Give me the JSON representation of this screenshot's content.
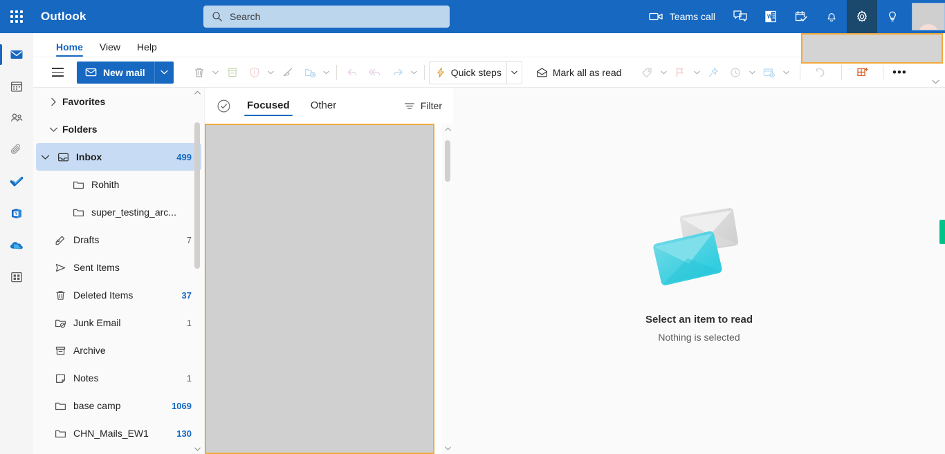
{
  "app": {
    "brand": "Outlook",
    "accent_blue": "#1668c1",
    "highlight_orange": "#f2a93b",
    "green_marker": "#00c389"
  },
  "header": {
    "waffle_name": "app-launcher-icon",
    "search": {
      "placeholder": "Search",
      "value": "",
      "icon": "search-icon"
    },
    "right_items": [
      {
        "id": "teams-call",
        "label": "Teams call",
        "icon": "video-camera-icon",
        "active": false
      },
      {
        "id": "chat",
        "label": "",
        "icon": "chat-bubbles-icon",
        "active": false
      },
      {
        "id": "office-app",
        "label": "",
        "icon": "office-word-icon",
        "active": false
      },
      {
        "id": "to-do",
        "label": "",
        "icon": "calendar-check-icon",
        "active": false
      },
      {
        "id": "notifications",
        "label": "",
        "icon": "bell-icon",
        "active": false
      },
      {
        "id": "settings",
        "label": "",
        "icon": "gear-icon",
        "active": true
      },
      {
        "id": "tips",
        "label": "",
        "icon": "lightbulb-icon",
        "active": false
      }
    ],
    "avatar_name": "user-avatar"
  },
  "ribbon": {
    "tabs": [
      {
        "label": "Home",
        "selected": true
      },
      {
        "label": "View",
        "selected": false
      },
      {
        "label": "Help",
        "selected": false
      }
    ],
    "hamburger": "nav-toggle-icon",
    "new_mail": {
      "label": "New mail",
      "icon": "envelope-icon",
      "caret": "chevron-down-icon"
    },
    "commands": [
      {
        "id": "delete",
        "label": "",
        "icon": "trash-icon",
        "caret": true,
        "enabled": false
      },
      {
        "id": "archive",
        "label": "",
        "icon": "archive-box-icon",
        "caret": false,
        "enabled": false
      },
      {
        "id": "report-junk",
        "label": "",
        "icon": "shield-alert-icon",
        "caret": true,
        "enabled": false
      },
      {
        "id": "sweep",
        "label": "",
        "icon": "broom-icon",
        "caret": false,
        "enabled": false
      },
      {
        "id": "move-to",
        "label": "",
        "icon": "folder-move-icon",
        "caret": true,
        "enabled": false
      },
      {
        "id": "reply",
        "label": "",
        "icon": "reply-arrow-icon",
        "caret": false,
        "enabled": false
      },
      {
        "id": "reply-all",
        "label": "",
        "icon": "reply-all-arrow-icon",
        "caret": false,
        "enabled": false
      },
      {
        "id": "forward",
        "label": "",
        "icon": "forward-arrow-icon",
        "caret": true,
        "enabled": false
      }
    ],
    "quick_steps": {
      "label": "Quick steps",
      "icon": "lightning-bolt-icon",
      "caret": "chevron-down-icon"
    },
    "mark_all_read": {
      "label": "Mark all as read",
      "icon": "open-envelope-icon"
    },
    "commands2": [
      {
        "id": "categorize",
        "label": "",
        "icon": "tag-icon",
        "caret": true,
        "enabled": false
      },
      {
        "id": "flag",
        "label": "",
        "icon": "flag-icon",
        "caret": true,
        "enabled": false
      },
      {
        "id": "pin",
        "label": "",
        "icon": "pin-icon",
        "caret": false,
        "enabled": false
      },
      {
        "id": "snooze",
        "label": "",
        "icon": "clock-icon",
        "caret": true,
        "enabled": false
      },
      {
        "id": "rules",
        "label": "",
        "icon": "rules-gear-icon",
        "caret": true,
        "enabled": false
      }
    ],
    "undo": {
      "id": "undo",
      "icon": "undo-arrow-icon",
      "enabled": false
    },
    "addins": {
      "id": "get-add-ins",
      "icon": "add-ins-icon",
      "enabled": true
    },
    "overflow": {
      "id": "more-commands",
      "label": "•••"
    },
    "collapse": {
      "id": "collapse-ribbon",
      "icon": "chevron-down-icon"
    }
  },
  "rail": {
    "items": [
      {
        "id": "mail",
        "icon": "mail-icon",
        "selected": true
      },
      {
        "id": "calendar",
        "icon": "calendar-icon",
        "selected": false
      },
      {
        "id": "people",
        "icon": "people-icon",
        "selected": false
      },
      {
        "id": "files",
        "icon": "paperclip-icon",
        "selected": false
      },
      {
        "id": "to-do",
        "icon": "checkmark-icon",
        "selected": false
      },
      {
        "id": "viva-engage",
        "icon": "viva-engage-icon",
        "selected": false
      },
      {
        "id": "onedrive",
        "icon": "cloud-icon",
        "selected": false
      },
      {
        "id": "more-apps",
        "icon": "apps-grid-icon",
        "selected": false
      }
    ]
  },
  "folder_pane": {
    "sections": [
      {
        "id": "favorites",
        "label": "Favorites",
        "expanded": false,
        "chevron": "chevron-right-icon"
      },
      {
        "id": "folders",
        "label": "Folders",
        "expanded": true,
        "chevron": "chevron-down-icon"
      }
    ],
    "folders": [
      {
        "id": "inbox",
        "label": "Inbox",
        "count": "499",
        "icon": "inbox-icon",
        "selected": true,
        "twisty": "chevron-down-icon",
        "indent": 0
      },
      {
        "id": "rohith",
        "label": "Rohith",
        "count": "",
        "icon": "folder-icon",
        "selected": false,
        "twisty": "",
        "indent": 2
      },
      {
        "id": "super-testing-arc",
        "label": "super_testing_arc...",
        "count": "",
        "icon": "folder-icon",
        "selected": false,
        "twisty": "",
        "indent": 2
      },
      {
        "id": "drafts",
        "label": "Drafts",
        "count": "7",
        "icon": "drafts-pencil-icon",
        "selected": false,
        "twisty": "",
        "indent": 1
      },
      {
        "id": "sent-items",
        "label": "Sent Items",
        "count": "",
        "icon": "send-icon",
        "selected": false,
        "twisty": "",
        "indent": 1
      },
      {
        "id": "deleted-items",
        "label": "Deleted Items",
        "count": "37",
        "icon": "trash-icon",
        "selected": false,
        "twisty": "",
        "indent": 1,
        "count_blue": true
      },
      {
        "id": "junk-email",
        "label": "Junk Email",
        "count": "1",
        "icon": "junk-folder-icon",
        "selected": false,
        "twisty": "",
        "indent": 1
      },
      {
        "id": "archive",
        "label": "Archive",
        "count": "",
        "icon": "archive-box-icon",
        "selected": false,
        "twisty": "",
        "indent": 1
      },
      {
        "id": "notes",
        "label": "Notes",
        "count": "1",
        "icon": "note-icon",
        "selected": false,
        "twisty": "",
        "indent": 1
      },
      {
        "id": "base-camp",
        "label": "base camp",
        "count": "1069",
        "icon": "folder-icon",
        "selected": false,
        "twisty": "",
        "indent": 1,
        "count_blue": true
      },
      {
        "id": "chn-mails-ew1",
        "label": "CHN_Mails_EW1",
        "count": "130",
        "icon": "folder-icon",
        "selected": false,
        "twisty": "",
        "indent": 1,
        "count_blue": true
      }
    ],
    "scrollbar": {
      "up": "scroll-up-arrow-icon",
      "down": "scroll-down-arrow-icon"
    }
  },
  "message_list": {
    "select_all_icon": "select-all-circle-icon",
    "tabs": [
      {
        "id": "focused",
        "label": "Focused",
        "selected": true
      },
      {
        "id": "other",
        "label": "Other",
        "selected": false
      }
    ],
    "filter": {
      "label": "Filter",
      "icon": "filter-icon"
    },
    "items": [],
    "empty_note": "",
    "scrollbar": {
      "up": "scroll-up-arrow-icon",
      "down": "scroll-down-arrow-icon"
    }
  },
  "reading_pane": {
    "illustration": "two-envelopes-illustration",
    "title": "Select an item to read",
    "subtitle": "Nothing is selected"
  }
}
